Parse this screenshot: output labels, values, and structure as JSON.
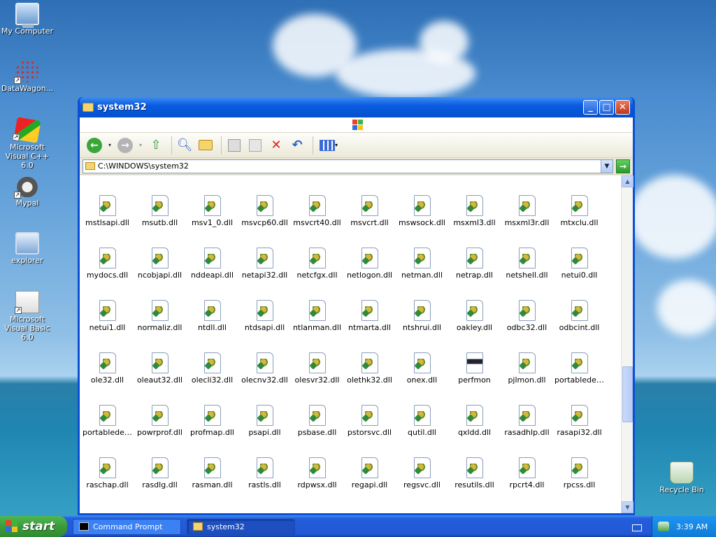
{
  "desktop": {
    "icons": [
      {
        "label": "My Computer"
      },
      {
        "label": "DataWagon..."
      },
      {
        "label": "Microsoft Visual C++ 6.0"
      },
      {
        "label": "Mypal"
      },
      {
        "label": "explorer"
      },
      {
        "label": "Microsoft Visual Basic 6.0"
      },
      {
        "label": "Recycle Bin"
      }
    ]
  },
  "window": {
    "title": "system32",
    "address": "C:\\WINDOWS\\system32",
    "toolbar_icons": [
      "back-icon",
      "dropdown-icon",
      "forward-icon",
      "dropdown-icon",
      "up-folder-icon",
      "search-icon",
      "folders-icon",
      "move-to-icon",
      "copy-to-icon",
      "delete-icon",
      "undo-icon",
      "views-icon"
    ],
    "files": [
      "mstlsapi.dll",
      "msutb.dll",
      "msv1_0.dll",
      "msvcp60.dll",
      "msvcrt40.dll",
      "msvcrt.dll",
      "mswsock.dll",
      "msxml3.dll",
      "msxml3r.dll",
      "mtxclu.dll",
      "mydocs.dll",
      "ncobjapi.dll",
      "nddeapi.dll",
      "netapi32.dll",
      "netcfgx.dll",
      "netlogon.dll",
      "netman.dll",
      "netrap.dll",
      "netshell.dll",
      "netui0.dll",
      "netui1.dll",
      "normaliz.dll",
      "ntdll.dll",
      "ntdsapi.dll",
      "ntlanman.dll",
      "ntmarta.dll",
      "ntshrui.dll",
      "oakley.dll",
      "odbc32.dll",
      "odbcint.dll",
      "ole32.dll",
      "oleaut32.dll",
      "olecli32.dll",
      "olecnv32.dll",
      "olesvr32.dll",
      "olethk32.dll",
      "onex.dll",
      "perfmon",
      "pjlmon.dll",
      "portabledev...",
      "portabledev...",
      "powrprof.dll",
      "profmap.dll",
      "psapi.dll",
      "psbase.dll",
      "pstorsvc.dll",
      "qutil.dll",
      "qxldd.dll",
      "rasadhlp.dll",
      "rasapi32.dll",
      "raschap.dll",
      "rasdlg.dll",
      "rasman.dll",
      "rastls.dll",
      "rdpwsx.dll",
      "regapi.dll",
      "regsvc.dll",
      "resutils.dll",
      "rpcrt4.dll",
      "rpcss.dll"
    ]
  },
  "taskbar": {
    "start_label": "start",
    "tasks": [
      {
        "label": "Command Prompt"
      },
      {
        "label": "system32"
      }
    ],
    "clock": "3:39 AM"
  }
}
